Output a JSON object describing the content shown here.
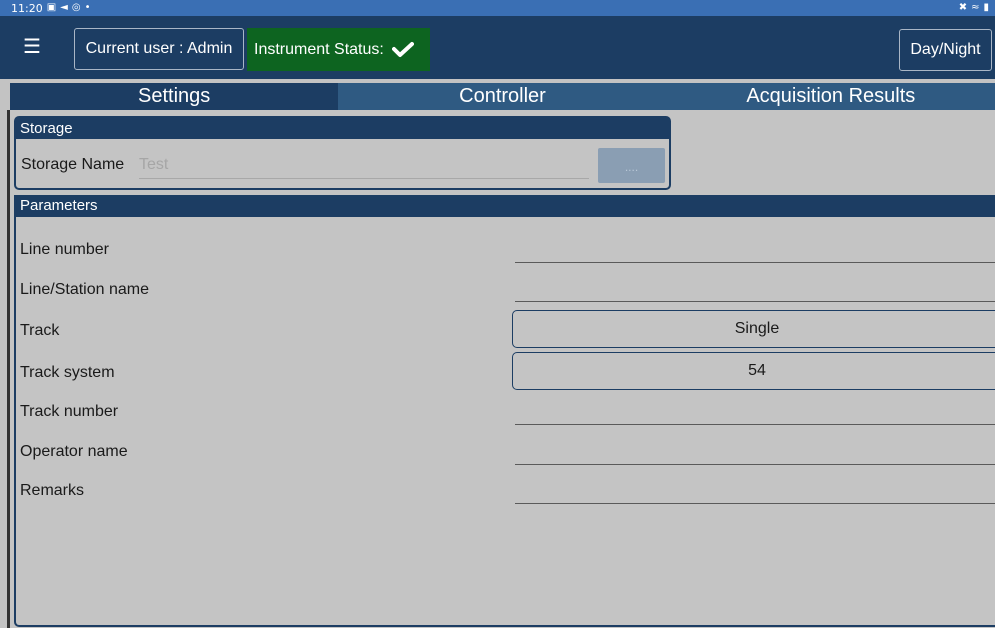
{
  "status_bar": {
    "time": "11:20",
    "left_icons": [
      "image-icon",
      "send-icon",
      "at-icon",
      "dot-icon"
    ],
    "right_icons": [
      "mute-icon",
      "wifi-icon",
      "battery-icon"
    ]
  },
  "app_bar": {
    "user_label": "Current user : Admin",
    "instrument_status_label": "Instrument Status:",
    "daynight_label": "Day/Night"
  },
  "tabs": [
    {
      "label": "Settings",
      "active": true
    },
    {
      "label": "Controller",
      "active": false
    },
    {
      "label": "Acquisition Results",
      "active": false
    }
  ],
  "storage": {
    "header": "Storage",
    "name_label": "Storage Name",
    "name_value": "Test",
    "browse_label": "...."
  },
  "parameters": {
    "header": "Parameters",
    "rows": [
      {
        "label": "Line number",
        "value": ""
      },
      {
        "label": "Line/Station name",
        "value": ""
      },
      {
        "label": "Track",
        "value": "Single"
      },
      {
        "label": "Track system",
        "value": "54"
      },
      {
        "label": "Track number",
        "value": ""
      },
      {
        "label": "Operator name",
        "value": ""
      },
      {
        "label": "Remarks",
        "value": ""
      }
    ]
  },
  "colors": {
    "app_bar": "#1c3d63",
    "status_ok": "#0d6420",
    "status_bar": "#3a6fb4",
    "background": "#c4c4c4"
  }
}
